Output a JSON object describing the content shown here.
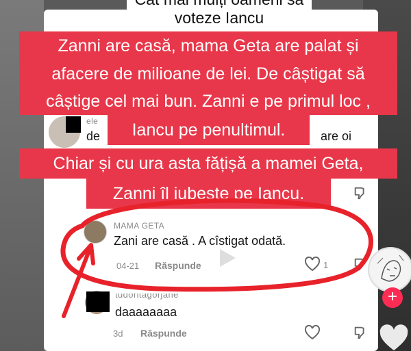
{
  "top_caption": {
    "line1": "Cât mai mulți oameni să",
    "line2": "voteze Iancu"
  },
  "captions": {
    "line1": "Zanni are casă, mama Geta are palat și",
    "line2": "afacere de milioane de lei. De câștigat să",
    "line3": "câștige cel mai bun. Zanni e pe primul loc ,",
    "line4": "Iancu pe penultimul.",
    "line5": "Chiar și cu ura asta fățișă a mamei Geta,",
    "line6": "Zanni îl iubește pe Iancu."
  },
  "comments": [
    {
      "username": "ele",
      "text_start": "de",
      "text_end": "are oi"
    },
    {
      "username": "MAMA GETA",
      "text": "Zani are casă . A cîstigat odată.",
      "date": "04-21",
      "reply": "Răspunde",
      "likes": "1"
    },
    {
      "username": "tudoritagorjane",
      "text": "daaaaaaaa",
      "date": "3d",
      "reply": "Răspunde"
    }
  ],
  "colors": {
    "caption_bg": "#e8374a",
    "annotation_red": "#e8222a",
    "tiktok_pink": "#fe2c55"
  },
  "icons": [
    "heart-icon",
    "dislike-icon",
    "plus-icon",
    "play-icon"
  ]
}
